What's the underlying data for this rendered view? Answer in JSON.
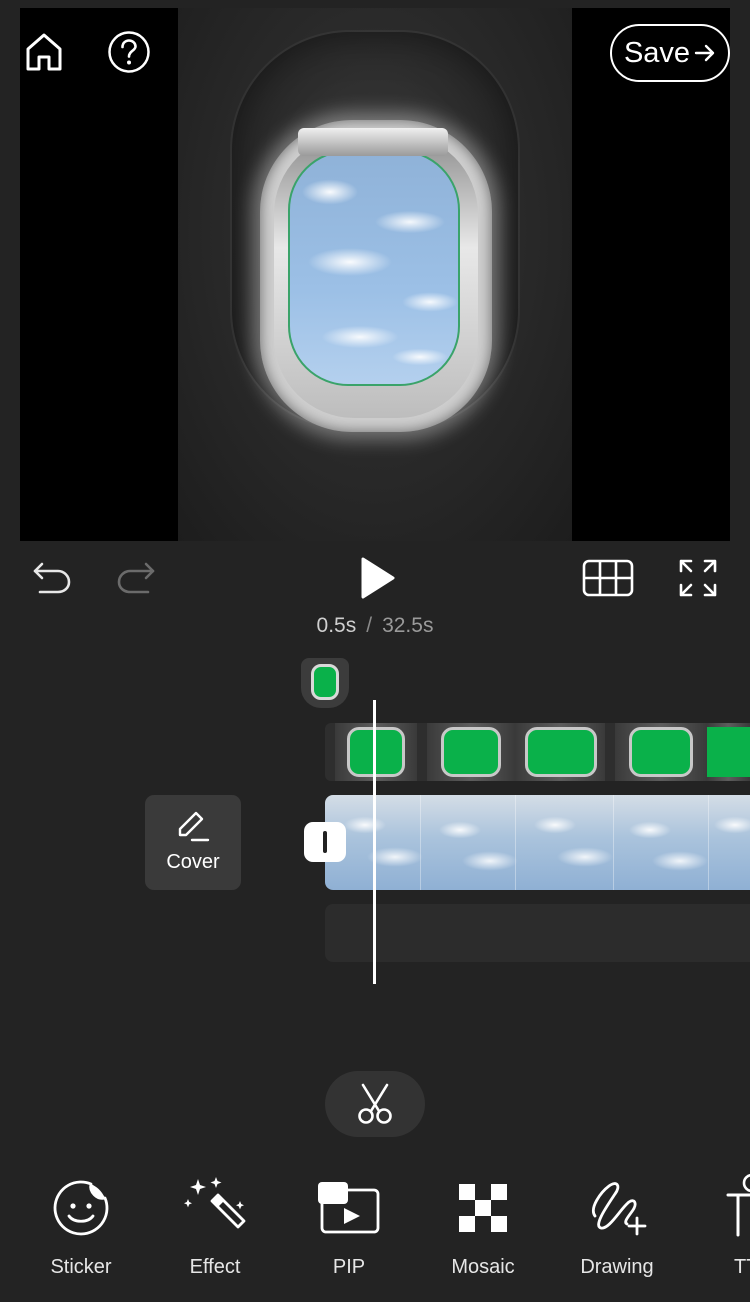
{
  "header": {
    "save_label": "Save"
  },
  "playback": {
    "current_time": "0.5s",
    "separator": "/",
    "total_time": "32.5s"
  },
  "timeline": {
    "cover_label": "Cover"
  },
  "toolbar": {
    "items": [
      {
        "label": "Sticker",
        "icon": "sticker-icon"
      },
      {
        "label": "Effect",
        "icon": "magic-wand-icon"
      },
      {
        "label": "PIP",
        "icon": "pip-icon"
      },
      {
        "label": "Mosaic",
        "icon": "mosaic-icon"
      },
      {
        "label": "Drawing",
        "icon": "drawing-icon"
      },
      {
        "label": "TT",
        "icon": "text-icon"
      }
    ]
  },
  "colors": {
    "background": "#232323",
    "accent_green": "#0ab14a",
    "panel": "#3a3a3a"
  }
}
